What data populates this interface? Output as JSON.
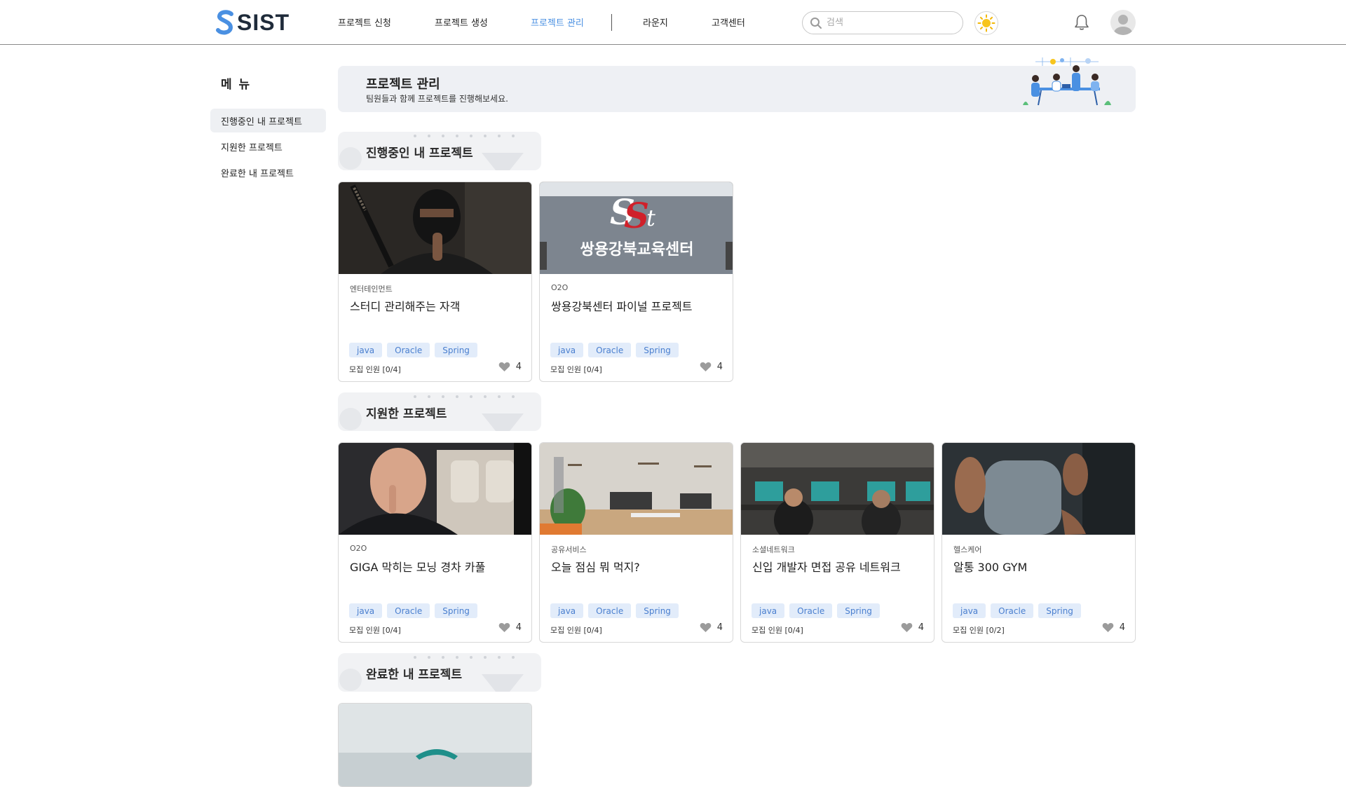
{
  "header": {
    "logo_text": "SIST",
    "nav": [
      {
        "label": "프로젝트 신청"
      },
      {
        "label": "프로젝트 생성"
      },
      {
        "label": "프로젝트 관리"
      },
      {
        "label": "라운지"
      },
      {
        "label": "고객센터"
      }
    ],
    "active_nav": "프로젝트 관리",
    "search_placeholder": "검색",
    "accent_color": "#4a90e2"
  },
  "sidebar": {
    "title": "메 뉴",
    "items": [
      {
        "label": "진행중인 내 프로젝트"
      },
      {
        "label": "지원한 프로젝트"
      },
      {
        "label": "완료한 내 프로젝트"
      }
    ]
  },
  "banner": {
    "title": "프로젝트 관리",
    "subtitle": "팀원들과 함께 프로젝트를 진행해보세요."
  },
  "sections": [
    {
      "title": "진행중인 내 프로젝트",
      "cards": [
        {
          "category": "엔터테인먼트",
          "title": "스터디 관리해주는 자객",
          "tags": [
            "java",
            "Oracle",
            "Spring"
          ],
          "recruit": "모집 인원 [0/4]",
          "likes": "4",
          "image": "ninja"
        },
        {
          "category": "O2O",
          "title": "쌍용강북센터 파이널 프로젝트",
          "tags": [
            "java",
            "Oracle",
            "Spring"
          ],
          "recruit": "모집 인원 [0/4]",
          "likes": "4",
          "image": "sist-sign",
          "image_text": "쌍용강북교육센터"
        }
      ]
    },
    {
      "title": "지원한 프로젝트",
      "cards": [
        {
          "category": "O2O",
          "title": "GIGA 막히는 모닝 경차 카풀",
          "tags": [
            "java",
            "Oracle",
            "Spring"
          ],
          "recruit": "모집 인원 [0/4]",
          "likes": "4",
          "image": "car-man"
        },
        {
          "category": "공유서비스",
          "title": "오늘 점심 뭐 먹지?",
          "tags": [
            "java",
            "Oracle",
            "Spring"
          ],
          "recruit": "모집 인원 [0/4]",
          "likes": "4",
          "image": "office"
        },
        {
          "category": "소셜네트워크",
          "title": "신입 개발자 면접 공유 네트워크",
          "tags": [
            "java",
            "Oracle",
            "Spring"
          ],
          "recruit": "모집 인원 [0/4]",
          "likes": "4",
          "image": "dev-room"
        },
        {
          "category": "헬스케어",
          "title": "알통 300 GYM",
          "tags": [
            "java",
            "Oracle",
            "Spring"
          ],
          "recruit": "모집 인원 [0/2]",
          "likes": "4",
          "image": "gym"
        }
      ]
    },
    {
      "title": "완료한 내 프로젝트",
      "cards": []
    }
  ]
}
